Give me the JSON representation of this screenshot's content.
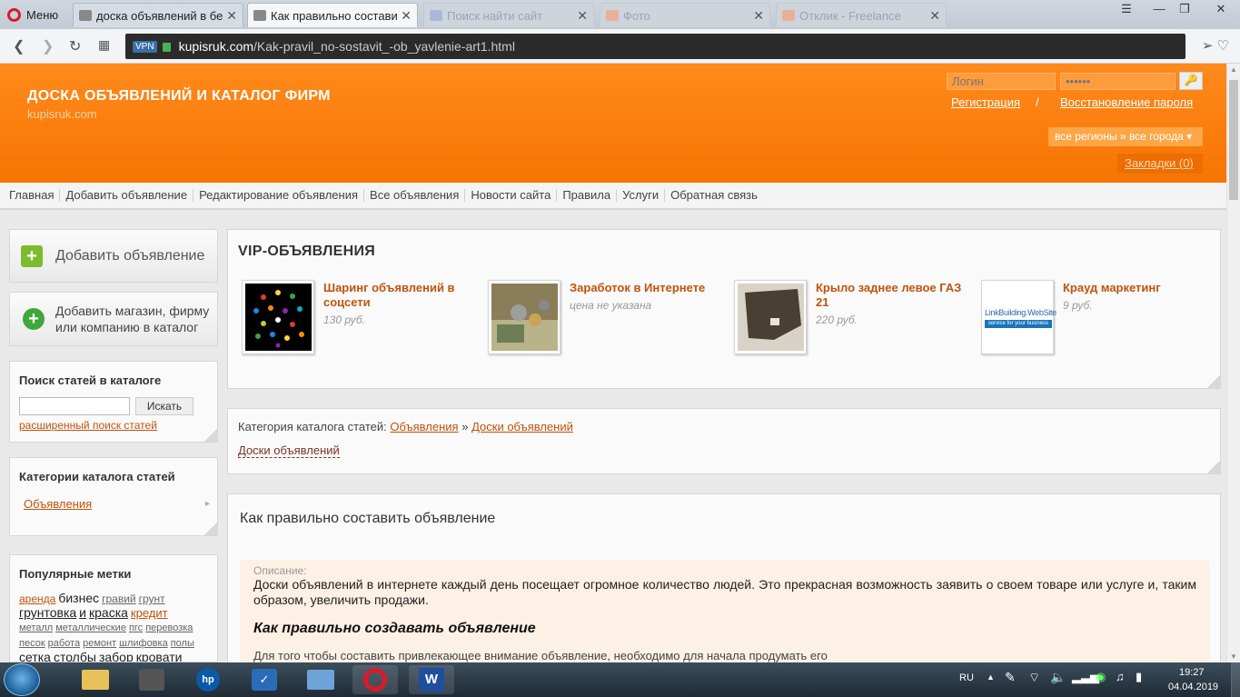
{
  "browser": {
    "menu_label": "Меню",
    "tabs": [
      {
        "title": "доска объявлений в бел"
      },
      {
        "title": "Как правильно составить"
      },
      {
        "title": "Поиск найти сайт"
      },
      {
        "title": "Фото"
      },
      {
        "title": "Отклик - Freelance"
      }
    ],
    "vpn_label": "VPN",
    "url_host": "kupisruk.com",
    "url_path": "/Kak-pravil_no-sostavit_-ob_yavlenie-art1.html"
  },
  "header": {
    "title": "ДОСКА ОБЪЯВЛЕНИЙ И КАТАЛОГ ФИРМ",
    "domain": "kupisruk.com",
    "login_placeholder": "Логин",
    "password_placeholder": "••••••",
    "register_link": "Регистрация",
    "separator": "/",
    "restore_link": "Восстановление пароля",
    "region_select": "все регионы » все города",
    "bookmarks": "Закладки (0)"
  },
  "nav": {
    "items": [
      "Главная",
      "Добавить объявление",
      "Редактирование объявления",
      "Все объявления",
      "Новости сайта",
      "Правила",
      "Услуги",
      "Обратная связь"
    ]
  },
  "sidebar": {
    "add_ad": "Добавить объявление",
    "add_company": "Добавить магазин, фирму или компанию в каталог",
    "search": {
      "title": "Поиск статей в каталоге",
      "button": "Искать",
      "advanced": "расширенный поиск статей"
    },
    "categories": {
      "title": "Категории каталога статей",
      "item": "Объявления"
    },
    "tags": {
      "title": "Популярные метки",
      "items": [
        "аренда",
        "бизнес",
        "гравий",
        "грунт",
        "грунтовка",
        "и",
        "краска",
        "кредит",
        "металл",
        "металлические",
        "пгс",
        "перевозка",
        "песок",
        "работа",
        "ремонт",
        "шлифовка",
        "полы",
        "сетка",
        "столбы",
        "забор",
        "кровати"
      ]
    }
  },
  "vip": {
    "title": "VIP-ОБЪЯВЛЕНИЯ",
    "items": [
      {
        "title": "Шаринг объявлений в соцсети",
        "price": "130 руб."
      },
      {
        "title": "Заработок в Интернете",
        "price": "цена не указана"
      },
      {
        "title": "Крыло заднее левое ГАЗ 21",
        "price": "220 руб."
      },
      {
        "title": "Крауд маркетинг",
        "price": "9 руб.",
        "thumb_line1": "LinkBuilding.WebSite",
        "thumb_line2": "service for your business"
      }
    ]
  },
  "breadcrumb": {
    "prefix": "Категория каталога статей:",
    "crumb1": "Объявления",
    "sep": "»",
    "crumb2": "Доски объявлений",
    "tag_link": "Доски объявлений"
  },
  "article": {
    "title": "Как правильно составить объявление",
    "desc_label": "Описание:",
    "desc_text": "Доски объявлений в интернете каждый день посещает огромное количество людей. Это прекрасная возможность заявить о своем товаре или услуге и, таким образом, увеличить продажи.",
    "subheading": "Как правильно создавать объявление",
    "body_partial": "Для того чтобы составить привлекающее внимание объявление, необходимо для начала продумать его"
  },
  "taskbar": {
    "lang": "RU",
    "time": "19:27",
    "date": "04.04.2019"
  }
}
